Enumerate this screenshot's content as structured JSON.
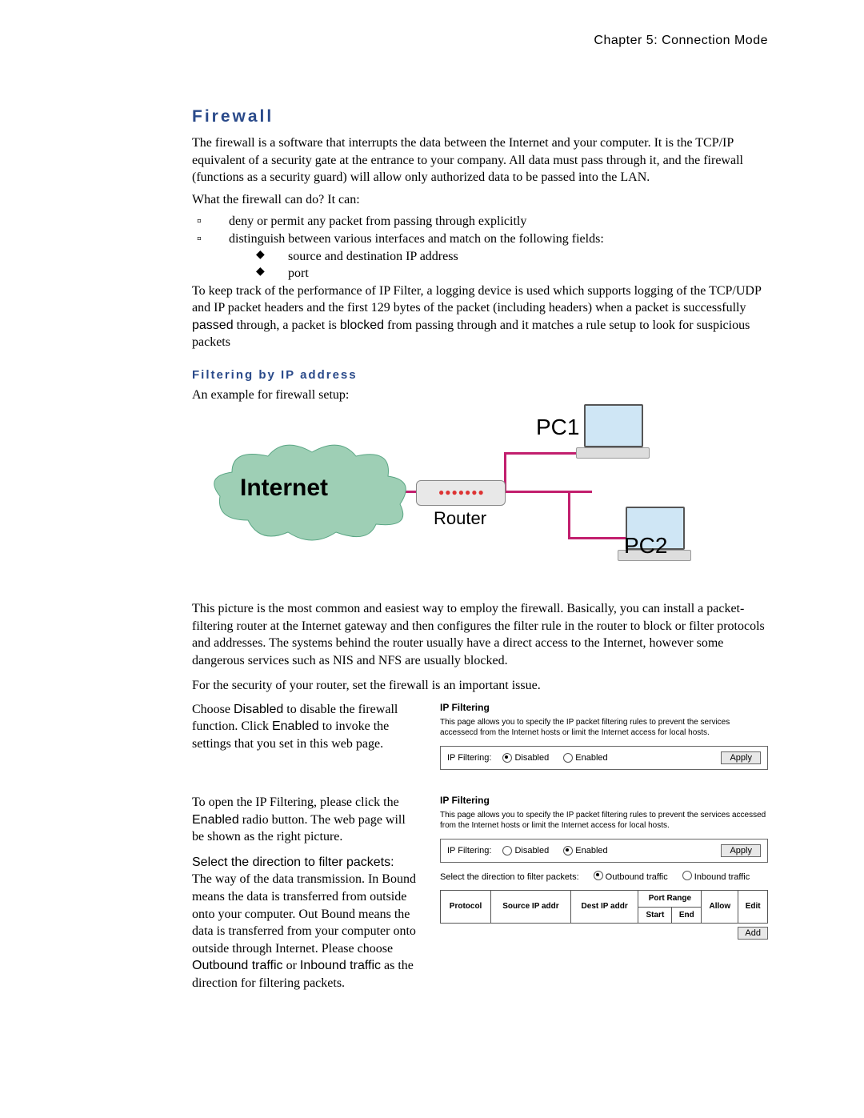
{
  "header": {
    "chapter": "Chapter 5: Connection Mode"
  },
  "section": {
    "title": "Firewall",
    "intro": "The firewall is a software that interrupts the data between the Internet and your computer. It is the TCP/IP equivalent of a security gate at the entrance to your company. All data must pass through it, and the firewall (functions as a security guard) will allow only authorized data to be passed into the LAN.",
    "question": "What the firewall can do? It can:",
    "list1": [
      "deny or permit any packet from passing through explicitly",
      "distinguish between various interfaces and match on the following fields:"
    ],
    "list2": [
      "source and destination IP address",
      "port"
    ],
    "para2a": "To keep track of the performance of IP Filter, a logging device is used which supports logging of the TCP/UDP and IP packet headers and the first 129 bytes of the packet (including headers) when a packet is successfully ",
    "para2_passed": "passed",
    "para2b": " through, a packet is ",
    "para2_blocked": "blocked",
    "para2c": " from passing through and it matches a rule setup to look for suspicious packets",
    "subheading": "Filtering by IP address",
    "example_line": "An example for firewall setup:"
  },
  "diagram": {
    "internet": "Internet",
    "router": "Router",
    "pc1": "PC1",
    "pc2": "PC2"
  },
  "after_diagram": {
    "p1": "This picture is the most common and easiest way to employ the firewall. Basically, you can install a packet-filtering router at the Internet gateway and then configures the filter rule in the router to block or filter protocols and addresses. The systems behind the router usually have a direct access to the Internet, however some dangerous services such as NIS and NFS are usually blocked.",
    "p2": "For the security of your router, set the firewall is an important issue."
  },
  "block1": {
    "left_a": "Choose ",
    "left_disabled": "Disabled",
    "left_b": " to disable the firewall function. Click ",
    "left_enabled": "Enabled",
    "left_c": " to invoke the settings that you set in this web page.",
    "panel_title": "IP Filtering",
    "panel_desc": "This page allows you to specify the IP packet filtering rules to prevent the services accessecd from the Internet hosts or limit the Internet access for local hosts.",
    "filtering_label": "IP Filtering:",
    "opt_disabled": "Disabled",
    "opt_enabled": "Enabled",
    "apply": "Apply"
  },
  "block2": {
    "left_a": "To open the IP Filtering, please click the ",
    "left_enabled": "Enabled",
    "left_b": " radio button. The web page will be shown as the right picture.",
    "left_c_title": "Select the direction to filter packets:",
    "left_c": "The way of the data transmission. In Bound means the data is transferred from outside onto your computer. Out Bound means the data is transferred from your computer onto outside through Internet. Please choose ",
    "left_out": "Outbound traffic",
    "left_or": " or ",
    "left_in": "Inbound traffic",
    "left_d": " as the direction for filtering packets.",
    "panel_title": "IP Filtering",
    "panel_desc": "This page allows you to specify the IP packet filtering rules to prevent the services accessed from the Internet hosts or limit the Internet access for local hosts.",
    "filtering_label": "IP Filtering:",
    "opt_disabled": "Disabled",
    "opt_enabled": "Enabled",
    "apply": "Apply",
    "direction_label": "Select the direction to filter packets:",
    "dir_out": "Outbound traffic",
    "dir_in": "Inbound traffic",
    "table": {
      "protocol": "Protocol",
      "src": "Source IP addr",
      "dst": "Dest IP addr",
      "portrange": "Port Range",
      "start": "Start",
      "end": "End",
      "allow": "Allow",
      "edit": "Edit"
    },
    "add": "Add"
  }
}
